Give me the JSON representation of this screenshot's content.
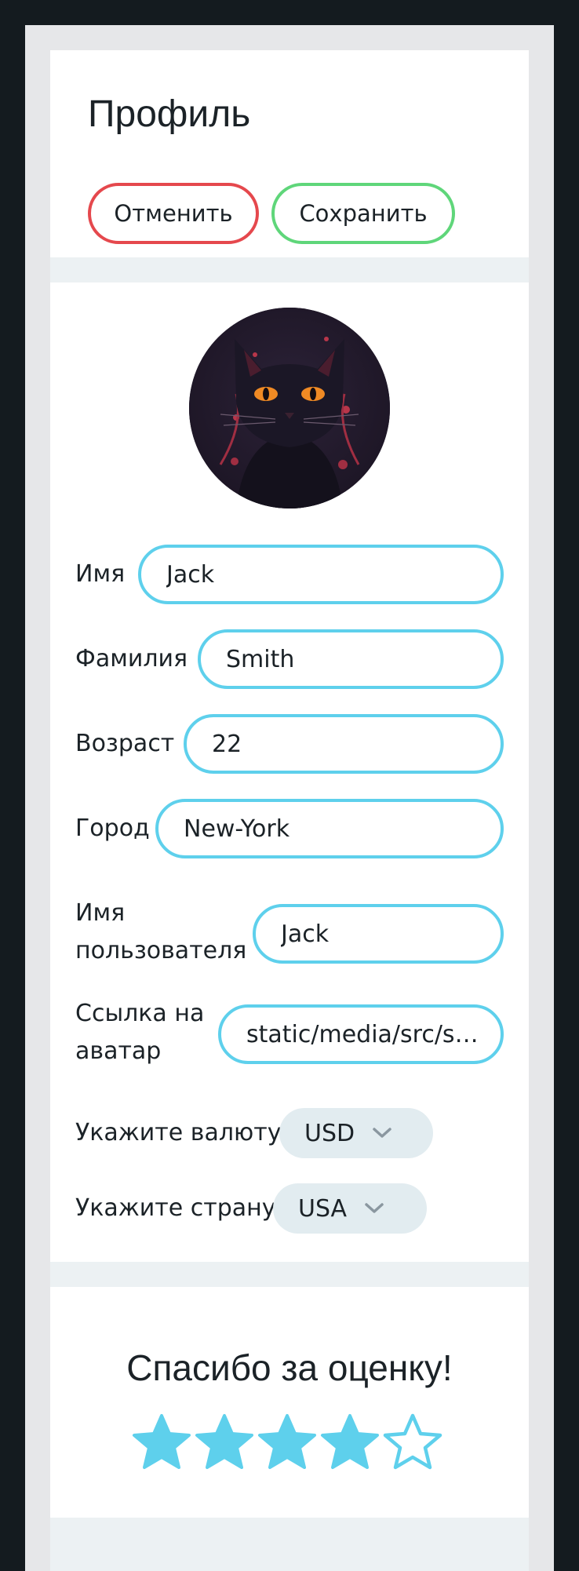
{
  "header": {
    "title": "Профиль",
    "cancel_label": "Отменить",
    "save_label": "Сохранить"
  },
  "profile": {
    "avatar_icon": "cat-avatar",
    "fields": {
      "first_name": {
        "label": "Имя",
        "value": "Jack"
      },
      "last_name": {
        "label": "Фамилия",
        "value": "Smith"
      },
      "age": {
        "label": "Возраст",
        "value": "22"
      },
      "city": {
        "label": "Город",
        "value": "New-York"
      },
      "username": {
        "label_line1": "Имя",
        "label_line2": "пользователя",
        "value": "Jack"
      },
      "avatar_url": {
        "label_line1": "Ссылка на",
        "label_line2": "аватар",
        "value": "static/media/src/sh..."
      }
    },
    "currency": {
      "label": "Укажите валюту",
      "selected": "USD"
    },
    "country": {
      "label": "Укажите страну",
      "selected": "USA"
    }
  },
  "rating": {
    "title": "Спасибо за оценку!",
    "value": 4,
    "max": 5
  },
  "colors": {
    "accent": "#5ed0ec",
    "cancel": "#e5484d",
    "save": "#5fd67a"
  }
}
